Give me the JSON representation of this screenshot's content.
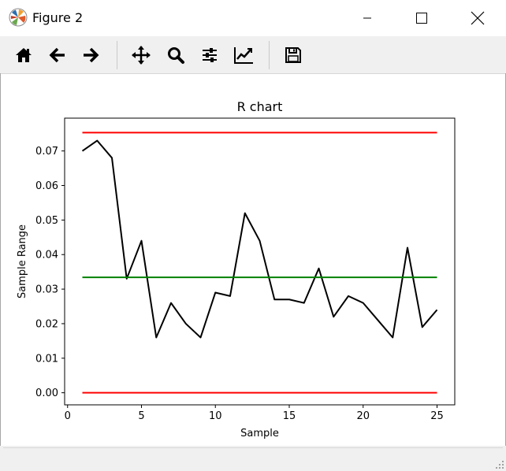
{
  "window": {
    "title": "Figure 2",
    "buttons": [
      "minimize",
      "maximize",
      "close"
    ]
  },
  "toolbar": {
    "tools": [
      {
        "name": "home-icon",
        "tooltip": "Home"
      },
      {
        "name": "back-icon",
        "tooltip": "Back"
      },
      {
        "name": "forward-icon",
        "tooltip": "Forward"
      },
      {
        "name": "pan-icon",
        "tooltip": "Pan"
      },
      {
        "name": "zoom-icon",
        "tooltip": "Zoom"
      },
      {
        "name": "configure-subplots-icon",
        "tooltip": "Subplots"
      },
      {
        "name": "edit-axis-icon",
        "tooltip": "Customize"
      },
      {
        "name": "save-icon",
        "tooltip": "Save"
      }
    ]
  },
  "chart_data": {
    "type": "line",
    "title": "R chart",
    "xlabel": "Sample",
    "ylabel": "Sample Range",
    "xlim": [
      -0.2,
      26.2
    ],
    "ylim": [
      -0.0035,
      0.0795
    ],
    "xticks": [
      0,
      5,
      10,
      15,
      20,
      25
    ],
    "yticks": [
      0.0,
      0.01,
      0.02,
      0.03,
      0.04,
      0.05,
      0.06,
      0.07
    ],
    "ytick_labels": [
      "0.00",
      "0.01",
      "0.02",
      "0.03",
      "0.04",
      "0.05",
      "0.06",
      "0.07"
    ],
    "grid": false,
    "series": [
      {
        "color": "#000000",
        "x": [
          1,
          2,
          3,
          4,
          5,
          6,
          7,
          8,
          9,
          10,
          11,
          12,
          13,
          14,
          15,
          16,
          17,
          18,
          19,
          20,
          21,
          22,
          23,
          24,
          25
        ],
        "values": [
          0.07,
          0.073,
          0.068,
          0.033,
          0.044,
          0.016,
          0.026,
          0.02,
          0.016,
          0.029,
          0.028,
          0.052,
          0.044,
          0.027,
          0.027,
          0.026,
          0.036,
          0.022,
          0.028,
          0.026,
          0.021,
          0.016,
          0.042,
          0.019,
          0.024
        ]
      },
      {
        "color": "#ff0000",
        "x": [
          1,
          25
        ],
        "values": [
          0.0753,
          0.0753
        ]
      },
      {
        "color": "#008000",
        "x": [
          1,
          25
        ],
        "values": [
          0.0334,
          0.0334
        ]
      },
      {
        "color": "#ff0000",
        "x": [
          1,
          25
        ],
        "values": [
          0.0,
          0.0
        ]
      }
    ]
  }
}
